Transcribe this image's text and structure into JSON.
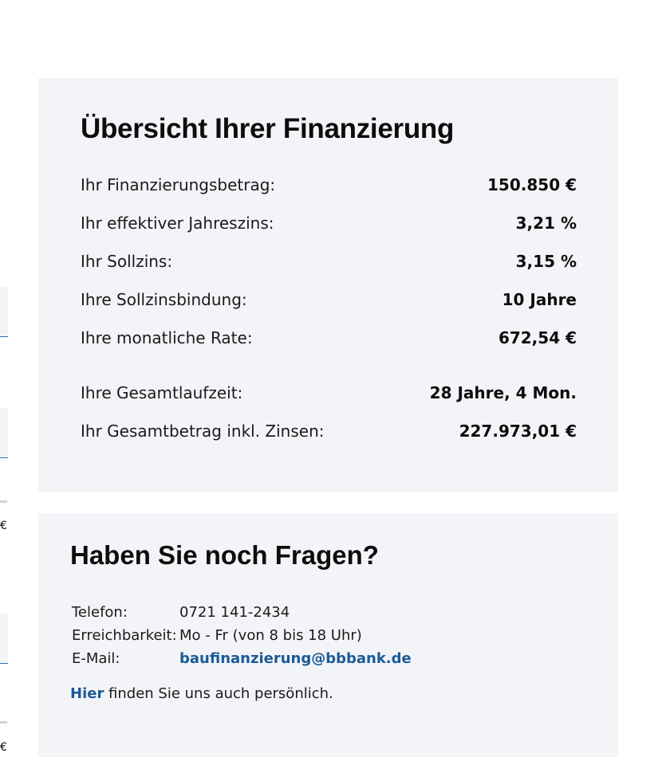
{
  "overview": {
    "title": "Übersicht Ihrer Finanzierung",
    "rows": [
      {
        "label": "Ihr Finanzierungsbetrag:",
        "value": "150.850 €"
      },
      {
        "label": "Ihr effektiver Jahreszins:",
        "value": "3,21 %"
      },
      {
        "label": "Ihr Sollzins:",
        "value": "3,15 %"
      },
      {
        "label": "Ihre Sollzinsbindung:",
        "value": "10 Jahre"
      },
      {
        "label": "Ihre monatliche Rate:",
        "value": "672,54 €"
      },
      {
        "label": "Ihre Gesamtlaufzeit:",
        "value": "28 Jahre, 4 Mon."
      },
      {
        "label": "Ihr Gesamtbetrag inkl. Zinsen:",
        "value": "227.973,01 €"
      }
    ]
  },
  "contact": {
    "title": "Haben Sie noch Fragen?",
    "phone_label": "Telefon:",
    "phone_value": "0721 141-2434",
    "hours_label": "Erreichbarkeit:",
    "hours_value": "Mo - Fr (von 8 bis 18 Uhr)",
    "email_label": "E-Mail:",
    "email_value": "baufinanzierung@bbbank.de",
    "here_link": "Hier",
    "here_text": " finden Sie uns auch persönlich."
  },
  "left_column": {
    "euro_1": "€",
    "euro_2": "€"
  },
  "colors": {
    "card_bg": "#f3f4f8",
    "link": "#1a5b96"
  }
}
